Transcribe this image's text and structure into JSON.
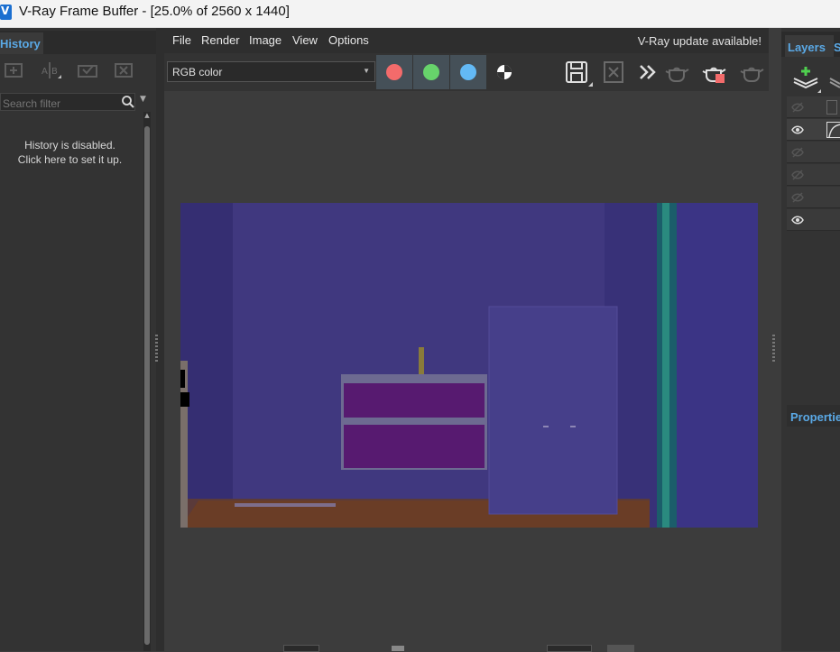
{
  "window": {
    "title": "V-Ray Frame Buffer - [25.0% of 2560 x 1440]"
  },
  "history": {
    "tab_label": "History",
    "search_placeholder": "Search filter",
    "message_line1": "History is disabled.",
    "message_line2": "Click here to set it up."
  },
  "menu": {
    "items": [
      "File",
      "Render",
      "Image",
      "View",
      "Options"
    ],
    "update_notice": "V-Ray update available!"
  },
  "toolbar": {
    "channel_value": "RGB color",
    "channel_colors": {
      "red": "#f36b6b",
      "green": "#67d36b",
      "blue": "#63b9f5"
    }
  },
  "layers": {
    "tab_label": "Layers",
    "second_tab_letter": "S",
    "properties_label": "Properties"
  },
  "colors": {
    "accent_blue": "#5aa9e6",
    "panel_bg": "#333333"
  }
}
